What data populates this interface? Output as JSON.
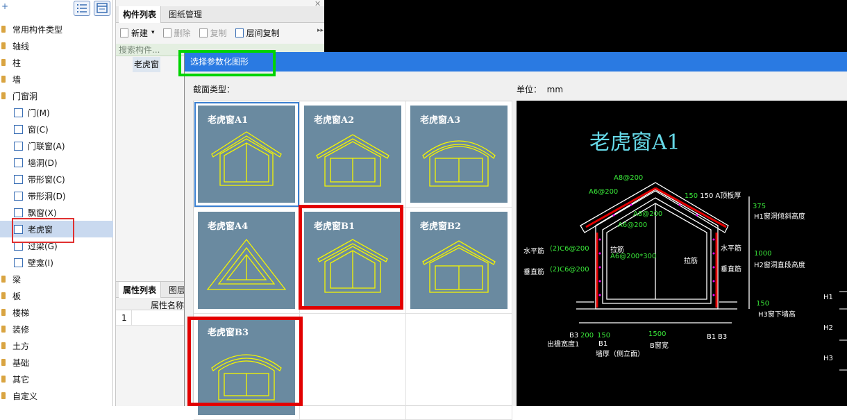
{
  "left_tree": {
    "items": [
      {
        "label": "常用构件类型",
        "type": "folder"
      },
      {
        "label": "轴线",
        "type": "folder"
      },
      {
        "label": "柱",
        "type": "folder"
      },
      {
        "label": "墙",
        "type": "folder"
      },
      {
        "label": "门窗洞",
        "type": "folder"
      },
      {
        "label": "门(M)",
        "type": "sub"
      },
      {
        "label": "窗(C)",
        "type": "sub"
      },
      {
        "label": "门联窗(A)",
        "type": "sub"
      },
      {
        "label": "墙洞(D)",
        "type": "sub"
      },
      {
        "label": "带形窗(C)",
        "type": "sub"
      },
      {
        "label": "带形洞(D)",
        "type": "sub"
      },
      {
        "label": "飘窗(X)",
        "type": "sub"
      },
      {
        "label": "老虎窗",
        "type": "sub",
        "selected": true
      },
      {
        "label": "过梁(G)",
        "type": "sub"
      },
      {
        "label": "壁龛(I)",
        "type": "sub"
      },
      {
        "label": "梁",
        "type": "folder"
      },
      {
        "label": "板",
        "type": "folder"
      },
      {
        "label": "楼梯",
        "type": "folder"
      },
      {
        "label": "装修",
        "type": "folder"
      },
      {
        "label": "土方",
        "type": "folder"
      },
      {
        "label": "基础",
        "type": "folder"
      },
      {
        "label": "其它",
        "type": "folder"
      },
      {
        "label": "自定义",
        "type": "folder"
      }
    ]
  },
  "mid_panel": {
    "tabs": [
      "构件列表",
      "图纸管理"
    ],
    "toolbar": {
      "new": "新建",
      "delete": "删除",
      "copy": "复制",
      "floor_copy": "层间复制"
    },
    "search_placeholder": "搜索构件...",
    "list_items": [
      "老虎窗"
    ],
    "prop_tabs": [
      "属性列表",
      "图层"
    ],
    "prop_header": "属性名称",
    "prop_row_index": "1"
  },
  "dialog": {
    "title": "选择参数化图形",
    "section_label": "截面类型：",
    "unit_label": "单位：",
    "unit_value": "mm",
    "thumbnails": [
      "老虎窗A1",
      "老虎窗A2",
      "老虎窗A3",
      "老虎窗A4",
      "老虎窗B1",
      "老虎窗B2",
      "老虎窗B3"
    ]
  },
  "preview": {
    "title": "老虎窗A1",
    "labels": {
      "a8_top": "A8@200",
      "a6_left": "A6@200",
      "a8_mid": "A8@200",
      "a6_mid": "A6@200",
      "top_thick": "150 A顶板厚",
      "h1_val": "375",
      "h1_text": "H1窗洞倾斜高度",
      "h_rebar": "水平筋",
      "h_rebar_spec": "(2)C6@200",
      "v_rebar": "垂直筋",
      "v_rebar_spec": "(2)C6@200",
      "tie": "拉筋",
      "tie_spec": "A6@200*300",
      "tie_right": "拉筋",
      "h_rebar_r": "水平筋",
      "v_rebar_r": "垂直筋",
      "h2_val": "1000",
      "h2_text": "H2窗洞直段高度",
      "h3_val": "150",
      "h3_text": "H3窗下墙高",
      "b3_l": "B3",
      "d200": "200",
      "d150": "150",
      "d1500": "1500",
      "b1_r": "B1",
      "b3_r": "B3",
      "eave": "出檐宽度1",
      "b1_l": "B1",
      "b_width": "B窗宽",
      "wall_thick": "墙厚（侧立面）",
      "h1": "H1",
      "h2": "H2",
      "h3": "H3"
    }
  }
}
